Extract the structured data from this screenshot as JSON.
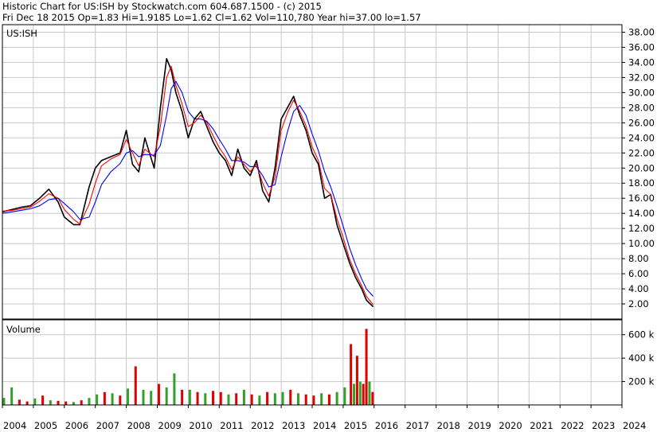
{
  "header": {
    "line1": "Historic Chart for US:ISH by Stockwatch.com 604.687.1500 - (c) 2015",
    "line2": "Fri Dec 18 2015   Op=1.83  Hi=1.9185  Lo=1.62  Cl=1.62  Vol=110,780  Year hi=37.00  lo=1.57"
  },
  "colors": {
    "price": "#000000",
    "ma_short": "#ff0000",
    "ma_long": "#0000ff",
    "vol_up": "#33a02c",
    "vol_down": "#e00000",
    "grid": "#c8c8c8"
  },
  "chart_data": [
    {
      "type": "line",
      "title": "US:ISH",
      "ylim": [
        0,
        39
      ],
      "y_ticks": [
        "2.00",
        "4.00",
        "6.00",
        "8.00",
        "10.00",
        "12.00",
        "14.00",
        "16.00",
        "18.00",
        "20.00",
        "22.00",
        "24.00",
        "26.00",
        "28.00",
        "30.00",
        "32.00",
        "34.00",
        "36.00",
        "38.00"
      ],
      "x_ticks": [
        "2004",
        "2005",
        "2006",
        "2007",
        "2008",
        "2009",
        "2010",
        "2011",
        "2012",
        "2013",
        "2014",
        "2015",
        "2016",
        "2017",
        "2018",
        "2019",
        "2020",
        "2021",
        "2022",
        "2023",
        "2024"
      ],
      "x": [
        2004.0,
        2004.3,
        2004.6,
        2004.9,
        2005.2,
        2005.5,
        2005.8,
        2006.0,
        2006.3,
        2006.5,
        2006.8,
        2007.0,
        2007.2,
        2007.5,
        2007.8,
        2008.0,
        2008.2,
        2008.4,
        2008.6,
        2008.9,
        2009.1,
        2009.3,
        2009.45,
        2009.6,
        2009.8,
        2010.0,
        2010.2,
        2010.4,
        2010.6,
        2010.8,
        2011.0,
        2011.2,
        2011.4,
        2011.6,
        2011.8,
        2012.0,
        2012.2,
        2012.4,
        2012.6,
        2012.8,
        2013.0,
        2013.2,
        2013.4,
        2013.6,
        2013.8,
        2014.0,
        2014.2,
        2014.4,
        2014.6,
        2014.8,
        2015.0,
        2015.2,
        2015.4,
        2015.6,
        2015.75,
        2015.97
      ],
      "series": [
        {
          "values": [
            14.2,
            14.5,
            14.8,
            15.0,
            16.0,
            17.2,
            15.5,
            13.5,
            12.5,
            12.5,
            17.5,
            20.0,
            21.0,
            21.5,
            22.0,
            25.0,
            20.5,
            19.5,
            24.0,
            20.0,
            28.0,
            34.5,
            33.0,
            30.0,
            27.5,
            24.0,
            26.5,
            27.5,
            25.5,
            23.5,
            22.0,
            21.0,
            19.0,
            22.5,
            20.0,
            19.0,
            21.0,
            17.0,
            15.5,
            20.0,
            26.5,
            28.0,
            29.5,
            27.0,
            25.0,
            22.0,
            20.5,
            16.0,
            16.5,
            12.5,
            10.0,
            7.5,
            5.5,
            4.0,
            2.5,
            1.62
          ]
        },
        {
          "values": [
            14.3,
            14.4,
            14.6,
            14.8,
            15.6,
            16.6,
            16.0,
            14.5,
            13.2,
            12.6,
            15.2,
            18.0,
            20.3,
            21.2,
            21.8,
            23.8,
            22.0,
            20.3,
            22.5,
            21.5,
            25.5,
            32.0,
            33.5,
            31.0,
            28.5,
            25.5,
            26.0,
            27.0,
            26.0,
            24.3,
            22.7,
            21.5,
            19.8,
            21.5,
            20.5,
            19.5,
            20.5,
            18.0,
            16.3,
            18.8,
            25.0,
            27.3,
            29.0,
            27.5,
            25.6,
            22.8,
            21.0,
            17.3,
            16.5,
            13.3,
            10.8,
            8.0,
            6.0,
            4.4,
            3.0,
            1.9
          ]
        },
        {
          "values": [
            14.0,
            14.2,
            14.4,
            14.6,
            15.0,
            15.8,
            16.0,
            15.3,
            14.2,
            13.2,
            13.5,
            15.5,
            17.8,
            19.5,
            20.6,
            22.0,
            22.3,
            21.5,
            21.8,
            21.7,
            23.0,
            27.0,
            30.5,
            31.5,
            30.0,
            27.5,
            26.5,
            26.5,
            26.2,
            25.2,
            23.8,
            22.5,
            21.0,
            21.0,
            20.8,
            20.2,
            20.2,
            19.0,
            17.5,
            17.8,
            21.5,
            24.8,
            27.5,
            28.3,
            27.0,
            24.5,
            22.3,
            19.5,
            17.5,
            15.0,
            12.3,
            9.5,
            7.2,
            5.3,
            4.0,
            3.0
          ]
        }
      ]
    },
    {
      "type": "bar",
      "title": "Volume",
      "ylim": [
        0,
        700000
      ],
      "y_ticks": [
        "200 k",
        "400 k",
        "600 k"
      ],
      "x": [
        2004.05,
        2004.3,
        2004.55,
        2004.8,
        2005.05,
        2005.3,
        2005.55,
        2005.8,
        2006.05,
        2006.3,
        2006.55,
        2006.8,
        2007.05,
        2007.3,
        2007.55,
        2007.8,
        2008.05,
        2008.3,
        2008.55,
        2008.8,
        2009.05,
        2009.3,
        2009.55,
        2009.8,
        2010.05,
        2010.3,
        2010.55,
        2010.8,
        2011.05,
        2011.3,
        2011.55,
        2011.8,
        2012.05,
        2012.3,
        2012.55,
        2012.8,
        2013.05,
        2013.3,
        2013.55,
        2013.8,
        2014.05,
        2014.3,
        2014.55,
        2014.8,
        2015.05,
        2015.25,
        2015.35,
        2015.45,
        2015.55,
        2015.65,
        2015.75,
        2015.85,
        2015.95
      ],
      "values": [
        60000,
        150000,
        45000,
        30000,
        55000,
        80000,
        40000,
        35000,
        30000,
        25000,
        40000,
        60000,
        90000,
        110000,
        100000,
        80000,
        140000,
        330000,
        130000,
        120000,
        180000,
        150000,
        270000,
        130000,
        130000,
        110000,
        100000,
        120000,
        110000,
        90000,
        100000,
        130000,
        90000,
        80000,
        110000,
        100000,
        110000,
        130000,
        100000,
        90000,
        80000,
        100000,
        90000,
        110000,
        150000,
        520000,
        180000,
        420000,
        200000,
        180000,
        650000,
        200000,
        110780
      ],
      "up": [
        1,
        1,
        0,
        0,
        1,
        0,
        1,
        0,
        0,
        1,
        0,
        1,
        1,
        0,
        1,
        0,
        1,
        0,
        1,
        1,
        0,
        1,
        1,
        0,
        1,
        0,
        1,
        0,
        0,
        1,
        0,
        1,
        0,
        1,
        0,
        1,
        1,
        0,
        1,
        0,
        0,
        1,
        0,
        1,
        1,
        0,
        1,
        0,
        1,
        0,
        0,
        1,
        0
      ]
    }
  ]
}
